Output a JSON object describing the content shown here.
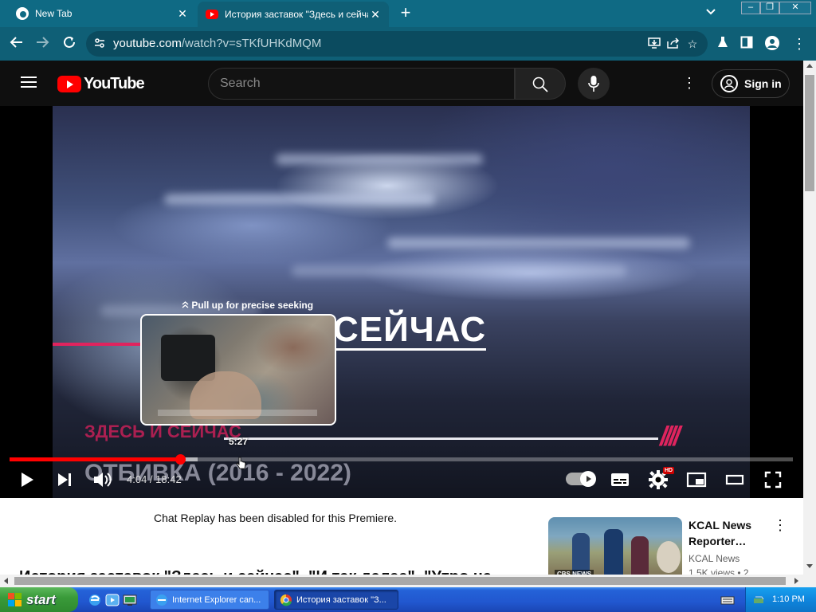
{
  "browser": {
    "tabs": [
      {
        "title": "New Tab",
        "active": false
      },
      {
        "title": "История заставок \"Здесь и сейча",
        "active": true
      }
    ],
    "new_tab_symbol": "+",
    "close_symbol": "✕",
    "url_host": "youtube.com",
    "url_path": "/watch?v=sTKfUHKdMQM"
  },
  "youtube": {
    "logo_text": "YouTube",
    "search_placeholder": "Search",
    "sign_in": "Sign in"
  },
  "video": {
    "overlay_title": "СЕЙЧАС",
    "overlay_sub1": "ЗДЕСЬ И СЕЙЧАС",
    "overlay_sub2": "ОТБИВКА (2016 - 2022)",
    "overlay_slashes": "////",
    "pull_up_hint": "Pull up for precise seeking",
    "seek_preview_time": "5:27",
    "current_time": "4:04",
    "duration": "18:42",
    "time_separator": " / ",
    "played_fraction": 0.218,
    "buffered_fraction": 0.24
  },
  "page": {
    "chat_replay": "Chat Replay has been disabled for this Premiere.",
    "video_title": "История заставок \"Здесь и сейчас\", \"И так далее\", \"Утро на",
    "related": {
      "title": "KCAL News Reporter…",
      "channel": "KCAL News",
      "meta": "1.5K views • 2",
      "thumb_tag": "CBS NEWS"
    }
  },
  "taskbar": {
    "start_label": "start",
    "tasks": [
      {
        "title": "Internet Explorer can...",
        "active": false
      },
      {
        "title": "История заставок \"З...",
        "active": true
      }
    ],
    "clock": "1:10 PM"
  },
  "colors": {
    "chrome_frame": "#0f6a84",
    "youtube_red": "#ff0000",
    "overlay_magenta": "#e0245e",
    "xp_blue": "#2157cf",
    "xp_green": "#3a9b3a"
  }
}
